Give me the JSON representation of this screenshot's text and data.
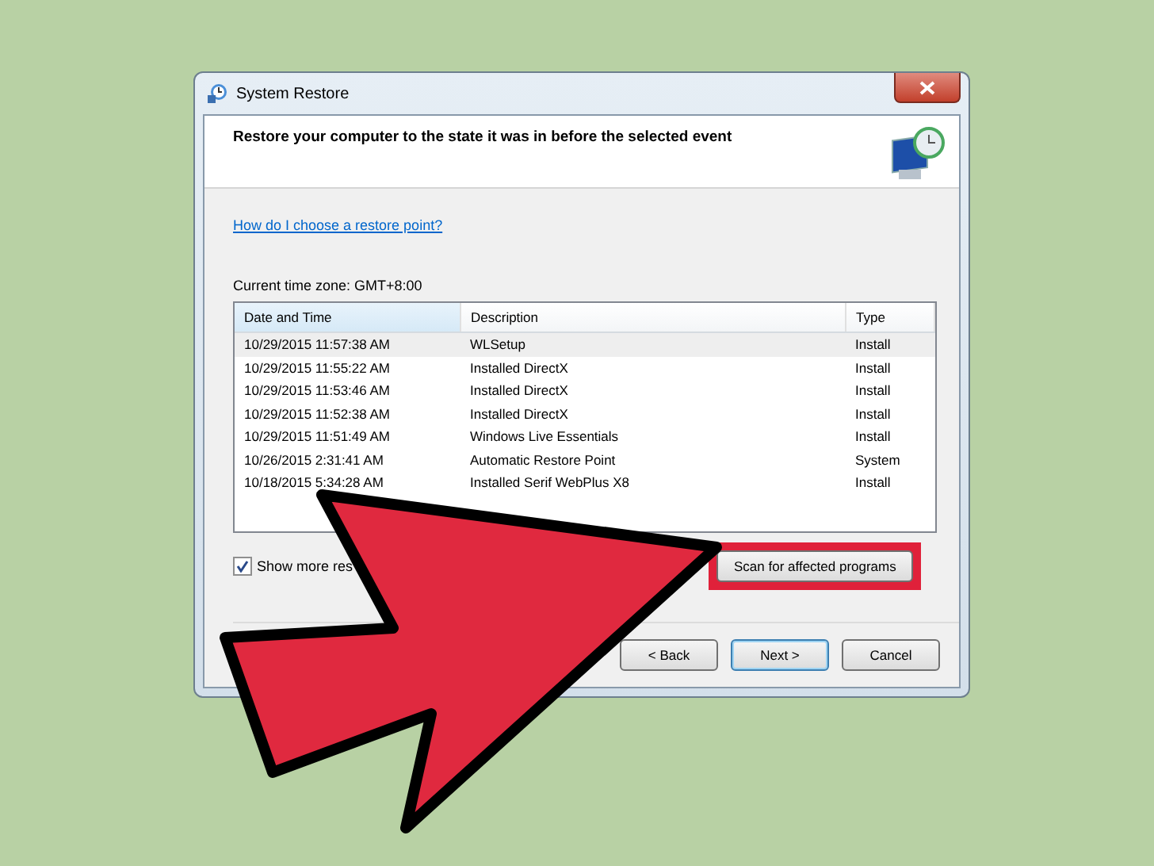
{
  "window": {
    "title": "System Restore"
  },
  "heading": "Restore your computer to the state it was in before the selected event",
  "help_link": "How do I choose a restore point?",
  "time_zone": "Current time zone: GMT+8:00",
  "table": {
    "columns": [
      "Date and Time",
      "Description",
      "Type"
    ],
    "rows": [
      {
        "cells": [
          "10/29/2015 11:57:38 AM",
          "WLSetup",
          "Install"
        ],
        "selected": true
      },
      {
        "cells": [
          "10/29/2015 11:55:22 AM",
          "Installed DirectX",
          "Install"
        ],
        "selected": false
      },
      {
        "cells": [
          "10/29/2015 11:53:46 AM",
          "Installed DirectX",
          "Install"
        ],
        "selected": false
      },
      {
        "cells": [
          "10/29/2015 11:52:38 AM",
          "Installed DirectX",
          "Install"
        ],
        "selected": false
      },
      {
        "cells": [
          "10/29/2015 11:51:49 AM",
          "Windows Live Essentials",
          "Install"
        ],
        "selected": false
      },
      {
        "cells": [
          "10/26/2015 2:31:41 AM",
          "Automatic Restore Point",
          "System"
        ],
        "selected": false
      },
      {
        "cells": [
          "10/18/2015 5:34:28 AM",
          "Installed Serif WebPlus X8",
          "Install"
        ],
        "selected": false
      }
    ]
  },
  "show_more": {
    "label": "Show more res",
    "checked": true
  },
  "scan_button": {
    "label": "Scan for affected programs",
    "highlighted": true
  },
  "buttons": [
    {
      "label": "< Back",
      "default": false
    },
    {
      "label": "Next >",
      "default": true
    },
    {
      "label": "Cancel",
      "default": false
    }
  ]
}
